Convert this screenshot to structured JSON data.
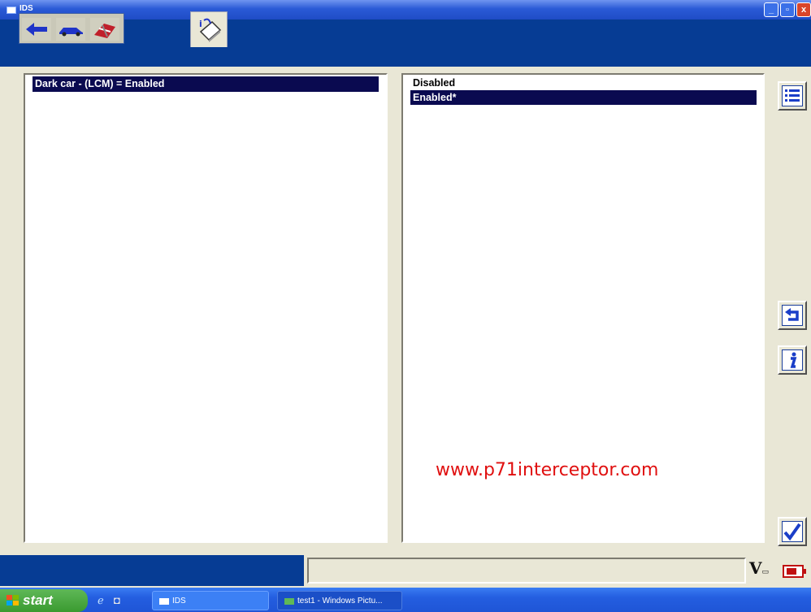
{
  "window": {
    "title": "IDS",
    "minimize": "_",
    "maximize": "▫",
    "close": "x"
  },
  "toolbar": {
    "tabs": [
      {
        "icon": "connect-arrow-icon"
      },
      {
        "icon": "vehicle-icon"
      },
      {
        "icon": "toolbox-icon"
      }
    ],
    "active_tab_icon": "config-book-icon"
  },
  "left_panel": {
    "selected_item": "Dark car - (LCM) = Enabled"
  },
  "right_panel": {
    "options": [
      "Disabled",
      "Enabled*"
    ],
    "selected_index": 1
  },
  "watermark": "www.p71interceptor.com",
  "side_buttons": [
    "list-icon",
    "back-arrow-icon",
    "info-icon",
    "checkmark-icon"
  ],
  "status": {
    "field_text": "",
    "voltage_symbol": "V"
  },
  "taskbar": {
    "start_label": "start",
    "tasks": [
      "IDS",
      "test1 - Windows Pictu..."
    ]
  },
  "colors": {
    "titlebar": "#2a5ad6",
    "toolbar": "#063c94",
    "selection": "#0a0a50",
    "watermark": "#e01010",
    "background": "#e9e7d6"
  }
}
